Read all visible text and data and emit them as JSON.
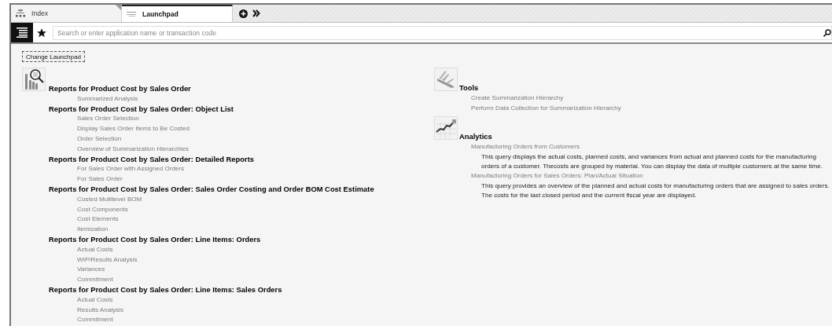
{
  "tabs": [
    {
      "label": "Index",
      "selected": false
    },
    {
      "label": "Launchpad",
      "selected": true
    }
  ],
  "search": {
    "placeholder": "Search or enter application name or transaction code"
  },
  "change_button": "Change Launchpad",
  "columns": [
    {
      "groups": [
        {
          "kind": "reports",
          "sections": [
            {
              "heading": "Reports for Product Cost by Sales Order",
              "items": [
                {
                  "label": "Summarized Analysis"
                }
              ]
            },
            {
              "heading": "Reports for Product Cost by Sales Order: Object List",
              "items": [
                {
                  "label": "Sales Order Selection"
                },
                {
                  "label": "Display Sales Order Items to Be Costed"
                },
                {
                  "label": "Order Selection"
                },
                {
                  "label": "Overview of Summarization Hierarchies"
                }
              ]
            },
            {
              "heading": "Reports for Product Cost by Sales Order: Detailed Reports",
              "items": [
                {
                  "label": "For Sales Order with Assigned Orders"
                },
                {
                  "label": "For Sales Order"
                }
              ]
            },
            {
              "heading": "Reports for Product Cost by Sales Order: Sales Order Costing and Order BOM Cost Estimate",
              "items": [
                {
                  "label": "Costed Multilevel BOM"
                },
                {
                  "label": "Cost Components"
                },
                {
                  "label": "Cost Elements"
                },
                {
                  "label": "Itemization"
                }
              ]
            },
            {
              "heading": "Reports for Product Cost by Sales Order: Line Items: Orders",
              "items": [
                {
                  "label": "Actual Costs"
                },
                {
                  "label": "WIP/Results Analysis"
                },
                {
                  "label": "Variances"
                },
                {
                  "label": "Commitment"
                }
              ]
            },
            {
              "heading": "Reports for Product Cost by Sales Order: Line Items: Sales Orders",
              "items": [
                {
                  "label": "Actual Costs"
                },
                {
                  "label": "Results Analysis"
                },
                {
                  "label": "Commitment"
                }
              ]
            }
          ]
        }
      ]
    },
    {
      "groups": [
        {
          "kind": "tools",
          "sections": [
            {
              "heading": "Tools",
              "items": [
                {
                  "label": "Create Summarization Hierarchy"
                },
                {
                  "label": "Perform Data Collection for Summarization Hierarchy"
                }
              ]
            }
          ]
        },
        {
          "kind": "analytics",
          "sections": [
            {
              "heading": "Analytics",
              "items": [
                {
                  "label": "Manufacturing Orders from Customers",
                  "description": "This query displays the actual costs, planned costs, and variances from actual and planned costs for the manufacturing orders of a customer. Thecosts are grouped by material. You can display the data of multiple customers at the same time."
                },
                {
                  "label": "Manufacturing Orders for Sales Orders: Plan/Actual Situation",
                  "description": "This query provides an overview of the planned and actual costs for manufacturing orders that are assigned to sales orders. The costs for the last closed period and the current fiscal year are displayed."
                }
              ]
            }
          ]
        }
      ]
    }
  ]
}
